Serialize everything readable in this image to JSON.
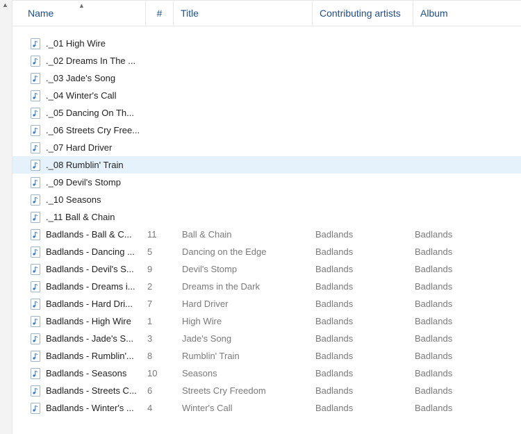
{
  "columns": {
    "name": "Name",
    "num": "#",
    "title": "Title",
    "artists": "Contributing artists",
    "album": "Album"
  },
  "rows": [
    {
      "name": "._01 High Wire",
      "num": "",
      "title": "",
      "artists": "",
      "album": "",
      "selected": false
    },
    {
      "name": "._02 Dreams In The ...",
      "num": "",
      "title": "",
      "artists": "",
      "album": "",
      "selected": false
    },
    {
      "name": "._03 Jade's Song",
      "num": "",
      "title": "",
      "artists": "",
      "album": "",
      "selected": false
    },
    {
      "name": "._04 Winter's Call",
      "num": "",
      "title": "",
      "artists": "",
      "album": "",
      "selected": false
    },
    {
      "name": "._05 Dancing On Th...",
      "num": "",
      "title": "",
      "artists": "",
      "album": "",
      "selected": false
    },
    {
      "name": "._06 Streets Cry Free...",
      "num": "",
      "title": "",
      "artists": "",
      "album": "",
      "selected": false
    },
    {
      "name": "._07 Hard Driver",
      "num": "",
      "title": "",
      "artists": "",
      "album": "",
      "selected": false
    },
    {
      "name": "._08 Rumblin' Train",
      "num": "",
      "title": "",
      "artists": "",
      "album": "",
      "selected": true
    },
    {
      "name": "._09 Devil's Stomp",
      "num": "",
      "title": "",
      "artists": "",
      "album": "",
      "selected": false
    },
    {
      "name": "._10 Seasons",
      "num": "",
      "title": "",
      "artists": "",
      "album": "",
      "selected": false
    },
    {
      "name": "._11 Ball & Chain",
      "num": "",
      "title": "",
      "artists": "",
      "album": "",
      "selected": false
    },
    {
      "name": "Badlands - Ball & C...",
      "num": "11",
      "title": "Ball & Chain",
      "artists": "Badlands",
      "album": "Badlands",
      "selected": false
    },
    {
      "name": "Badlands - Dancing ...",
      "num": "5",
      "title": "Dancing on the Edge",
      "artists": "Badlands",
      "album": "Badlands",
      "selected": false
    },
    {
      "name": "Badlands - Devil's S...",
      "num": "9",
      "title": "Devil's Stomp",
      "artists": "Badlands",
      "album": "Badlands",
      "selected": false
    },
    {
      "name": "Badlands - Dreams i...",
      "num": "2",
      "title": "Dreams in the Dark",
      "artists": "Badlands",
      "album": "Badlands",
      "selected": false
    },
    {
      "name": "Badlands - Hard Dri...",
      "num": "7",
      "title": "Hard Driver",
      "artists": "Badlands",
      "album": "Badlands",
      "selected": false
    },
    {
      "name": "Badlands - High Wire",
      "num": "1",
      "title": "High Wire",
      "artists": "Badlands",
      "album": "Badlands",
      "selected": false
    },
    {
      "name": "Badlands - Jade's S...",
      "num": "3",
      "title": "Jade's Song",
      "artists": "Badlands",
      "album": "Badlands",
      "selected": false
    },
    {
      "name": "Badlands - Rumblin'...",
      "num": "8",
      "title": "Rumblin' Train",
      "artists": "Badlands",
      "album": "Badlands",
      "selected": false
    },
    {
      "name": "Badlands - Seasons",
      "num": "10",
      "title": "Seasons",
      "artists": "Badlands",
      "album": "Badlands",
      "selected": false
    },
    {
      "name": "Badlands - Streets C...",
      "num": "6",
      "title": "Streets Cry Freedom",
      "artists": "Badlands",
      "album": "Badlands",
      "selected": false
    },
    {
      "name": "Badlands - Winter's ...",
      "num": "4",
      "title": "Winter's Call",
      "artists": "Badlands",
      "album": "Badlands",
      "selected": false
    }
  ]
}
